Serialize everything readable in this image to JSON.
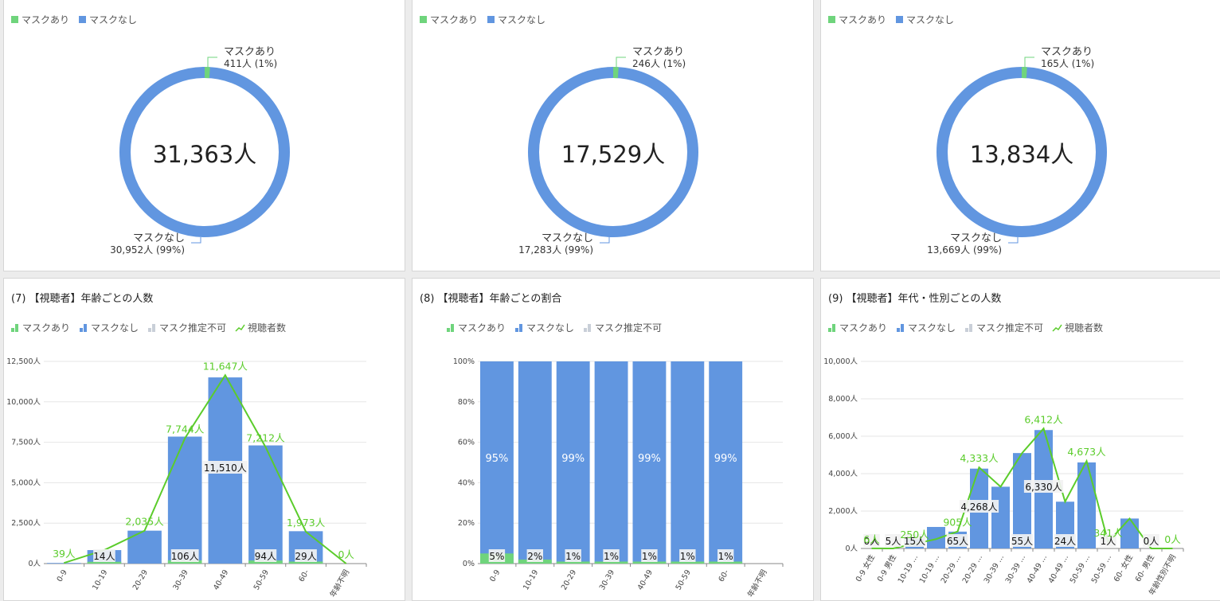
{
  "colors": {
    "mask_on": "#6fd47c",
    "mask_off": "#6196e0",
    "unknown": "#c9cfd8",
    "viewers_line": "#5bcc2b"
  },
  "donuts": [
    {
      "legend": [
        "マスクあり",
        "マスクなし"
      ],
      "center": "31,363人",
      "on_label": "マスクあり",
      "on_value": "411人 (1%)",
      "off_label": "マスクなし",
      "off_value": "30,952人 (99%)"
    },
    {
      "legend": [
        "マスクあり",
        "マスクなし"
      ],
      "center": "17,529人",
      "on_label": "マスクあり",
      "on_value": "246人 (1%)",
      "off_label": "マスクなし",
      "off_value": "17,283人 (99%)"
    },
    {
      "legend": [
        "マスクあり",
        "マスクなし"
      ],
      "center": "13,834人",
      "on_label": "マスクあり",
      "on_value": "165人 (1%)",
      "off_label": "マスクなし",
      "off_value": "13,669人 (99%)"
    }
  ],
  "chart7": {
    "title": "(7) 【視聴者】年齢ごとの人数",
    "legend": [
      "マスクあり",
      "マスクなし",
      "マスク推定不可",
      "視聴者数"
    ]
  },
  "chart8": {
    "title": "(8) 【視聴者】年齢ごとの割合",
    "legend": [
      "マスクあり",
      "マスクなし",
      "マスク推定不可"
    ]
  },
  "chart9": {
    "title": "(9) 【視聴者】年代・性別ごとの人数",
    "legend": [
      "マスクあり",
      "マスクなし",
      "マスク推定不可",
      "視聴者数"
    ]
  },
  "chart_data": [
    {
      "type": "pie",
      "labels": [
        "マスクあり",
        "マスクなし"
      ],
      "values": [
        411,
        30952
      ],
      "center_label": "31,363人"
    },
    {
      "type": "pie",
      "labels": [
        "マスクあり",
        "マスクなし"
      ],
      "values": [
        246,
        17283
      ],
      "center_label": "17,529人"
    },
    {
      "type": "pie",
      "labels": [
        "マスクあり",
        "マスクなし"
      ],
      "values": [
        165,
        13669
      ],
      "center_label": "13,834人"
    },
    {
      "type": "bar",
      "title": "(7) 【視聴者】年齢ごとの人数",
      "categories": [
        "0-9",
        "10-19",
        "20-29",
        "30-39",
        "40-49",
        "50-59",
        "60-",
        "年齢不明"
      ],
      "ylim": [
        0,
        12500
      ],
      "yticks": [
        "0人",
        "2,500人",
        "5,000人",
        "7,500人",
        "10,000人",
        "12,500人"
      ],
      "series": [
        {
          "name": "マスクあり",
          "values": [
            0,
            14,
            0,
            106,
            0,
            94,
            29,
            0
          ]
        },
        {
          "name": "マスクなし",
          "values": [
            39,
            820,
            2035,
            7744,
            11510,
            7212,
            1973,
            0
          ]
        },
        {
          "name": "視聴者数",
          "values": [
            39,
            834,
            2035,
            7744,
            11647,
            7212,
            1973,
            0
          ]
        }
      ],
      "bar_labels": [
        "",
        "14人",
        "",
        "106人",
        "11,510人",
        "94人",
        "29人",
        ""
      ],
      "line_labels": [
        "39人",
        "",
        "2,035人",
        "7,744人",
        "11,647人",
        "7,212人",
        "1,973人",
        "0人"
      ]
    },
    {
      "type": "bar",
      "title": "(8) 【視聴者】年齢ごとの割合",
      "categories": [
        "0-9",
        "10-19",
        "20-29",
        "30-39",
        "40-49",
        "50-59",
        "60-",
        "年齢不明"
      ],
      "ylim": [
        0,
        100
      ],
      "yticks": [
        "0%",
        "20%",
        "40%",
        "60%",
        "80%",
        "100%"
      ],
      "series": [
        {
          "name": "マスクあり",
          "values": [
            5,
            2,
            1,
            1,
            1,
            1,
            1,
            0
          ]
        },
        {
          "name": "マスクなし",
          "values": [
            95,
            98,
            99,
            99,
            99,
            99,
            99,
            0
          ]
        }
      ],
      "on_labels": [
        "5%",
        "2%",
        "1%",
        "1%",
        "1%",
        "1%",
        "1%",
        ""
      ],
      "off_labels": [
        "95%",
        "",
        "99%",
        "",
        "99%",
        "",
        "99%",
        ""
      ]
    },
    {
      "type": "bar",
      "title": "(9) 【視聴者】年代・性別ごとの人数",
      "categories": [
        "0-9 女性",
        "0-9 男性",
        "10-19 ...",
        "10-19 ...",
        "20-29 ...",
        "20-29 ...",
        "30-39 ...",
        "30-39 ...",
        "40-49 ...",
        "40-49 ...",
        "50-59 ...",
        "50-59 ...",
        "60- 女性",
        "60- 男性",
        "年齢性別不明"
      ],
      "ylim": [
        0,
        10000
      ],
      "yticks": [
        "0人",
        "2,000人",
        "4,000人",
        "6,000人",
        "8,000人",
        "10,000人"
      ],
      "series": [
        {
          "name": "マスクなし",
          "values": [
            0,
            0,
            500,
            1150,
            900,
            4268,
            3300,
            5100,
            6330,
            2500,
            4600,
            0,
            1600,
            0,
            0
          ]
        },
        {
          "name": "視聴者数",
          "values": [
            6,
            0,
            250,
            500,
            905,
            4333,
            3300,
            5100,
            6412,
            2500,
            4673,
            341,
            1600,
            0,
            0
          ]
        }
      ],
      "bar_labels": [
        "0人",
        "5人",
        "15人",
        "",
        "65人",
        "4,268人",
        "",
        "55人",
        "6,330人",
        "24人",
        "",
        "1人",
        "",
        "0人",
        ""
      ],
      "line_labels": [
        "6人",
        "250人",
        "905人",
        "4,333人",
        "6,412人",
        "4,673人",
        "341人",
        "0人"
      ]
    }
  ]
}
